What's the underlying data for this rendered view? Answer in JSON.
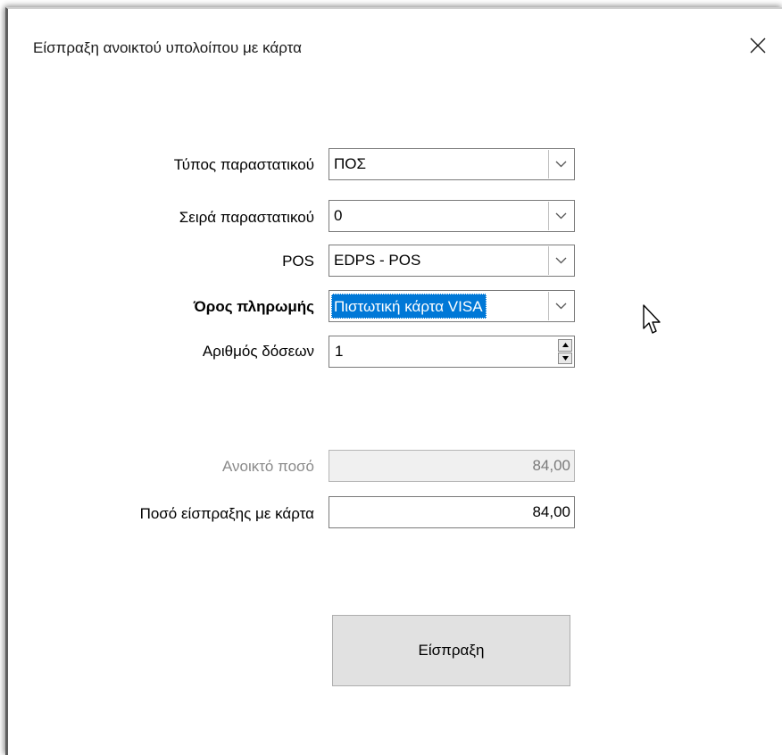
{
  "window": {
    "title": "Είσπραξη ανοικτού υπολοίπου με κάρτα"
  },
  "form": {
    "document_type": {
      "label": "Τύπος παραστατικού",
      "value": "ΠΟΣ"
    },
    "document_series": {
      "label": "Σειρά παραστατικού",
      "value": "0"
    },
    "pos": {
      "label": "POS",
      "value": "EDPS - POS"
    },
    "payment_term": {
      "label": "Όρος πληρωμής",
      "value": "Πιστωτική κάρτα VISA"
    },
    "installments": {
      "label": "Αριθμός δόσεων",
      "value": "1"
    },
    "open_amount": {
      "label": "Ανοικτό ποσό",
      "value": "84,00"
    },
    "card_amount": {
      "label": "Ποσό είσπραξης με κάρτα",
      "value": "84,00"
    }
  },
  "actions": {
    "collect_label": "Είσπραξη"
  },
  "icons": {
    "close": "close-icon",
    "dropdown": "chevron-down-icon",
    "spin_up": "spin-up-icon",
    "spin_down": "spin-down-icon",
    "cursor": "mouse-pointer-icon"
  },
  "colors": {
    "selection": "#0078d7",
    "button_face": "#e1e1e1",
    "disabled_field": "#f0f0f0"
  }
}
